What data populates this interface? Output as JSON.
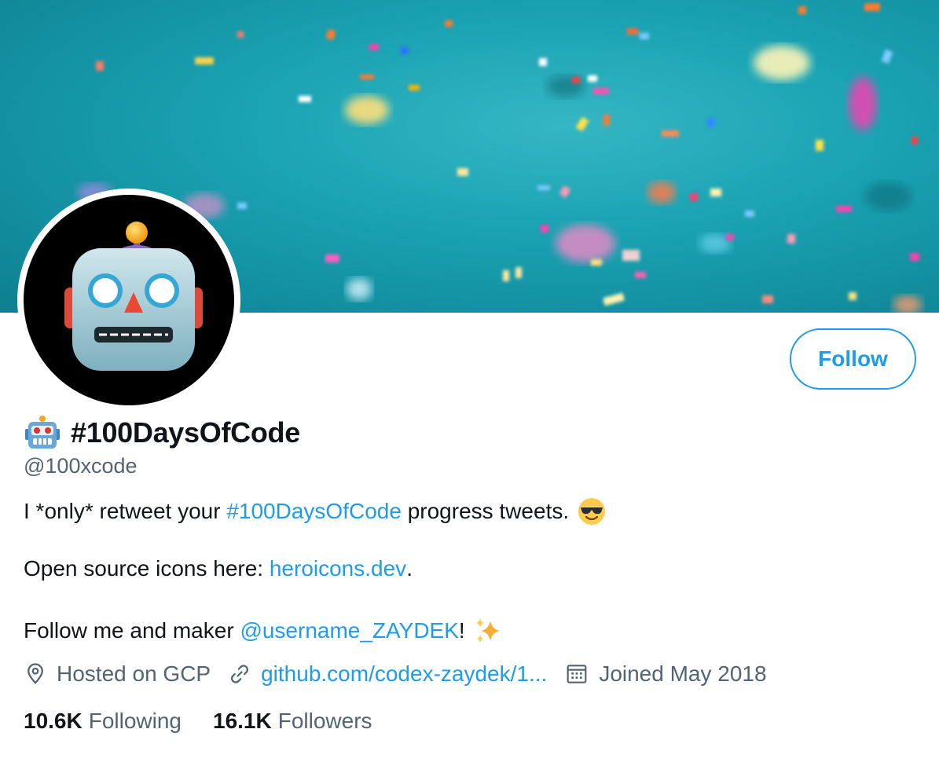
{
  "profile": {
    "display_name": "#100DaysOfCode",
    "handle": "@100xcode",
    "follow_label": "Follow"
  },
  "bio": {
    "line1_prefix": "I *only* retweet your ",
    "line1_hashtag": "#100DaysOfCode",
    "line1_suffix": " progress tweets.",
    "line1_emoji": "smiling-face-with-sunglasses-icon",
    "line2_prefix": "Open source icons here: ",
    "line2_link": "heroicons.dev",
    "line2_suffix": ".",
    "line3_prefix": "Follow me and maker ",
    "line3_mention": "@username_ZAYDEK",
    "line3_suffix": "!",
    "line3_emoji": "sparkles-icon"
  },
  "meta": {
    "location_icon": "location-pin-icon",
    "location": "Hosted on GCP",
    "url_icon": "link-icon",
    "url": "github.com/codex-zaydek/1...",
    "joined_icon": "calendar-icon",
    "joined": "Joined May 2018"
  },
  "stats": {
    "following_count": "10.6K",
    "following_label": "Following",
    "followers_count": "16.1K",
    "followers_label": "Followers"
  },
  "colors": {
    "accent": "#1d9bf0",
    "secondary_text": "#536471",
    "banner_teal": "#1aa3b3"
  }
}
